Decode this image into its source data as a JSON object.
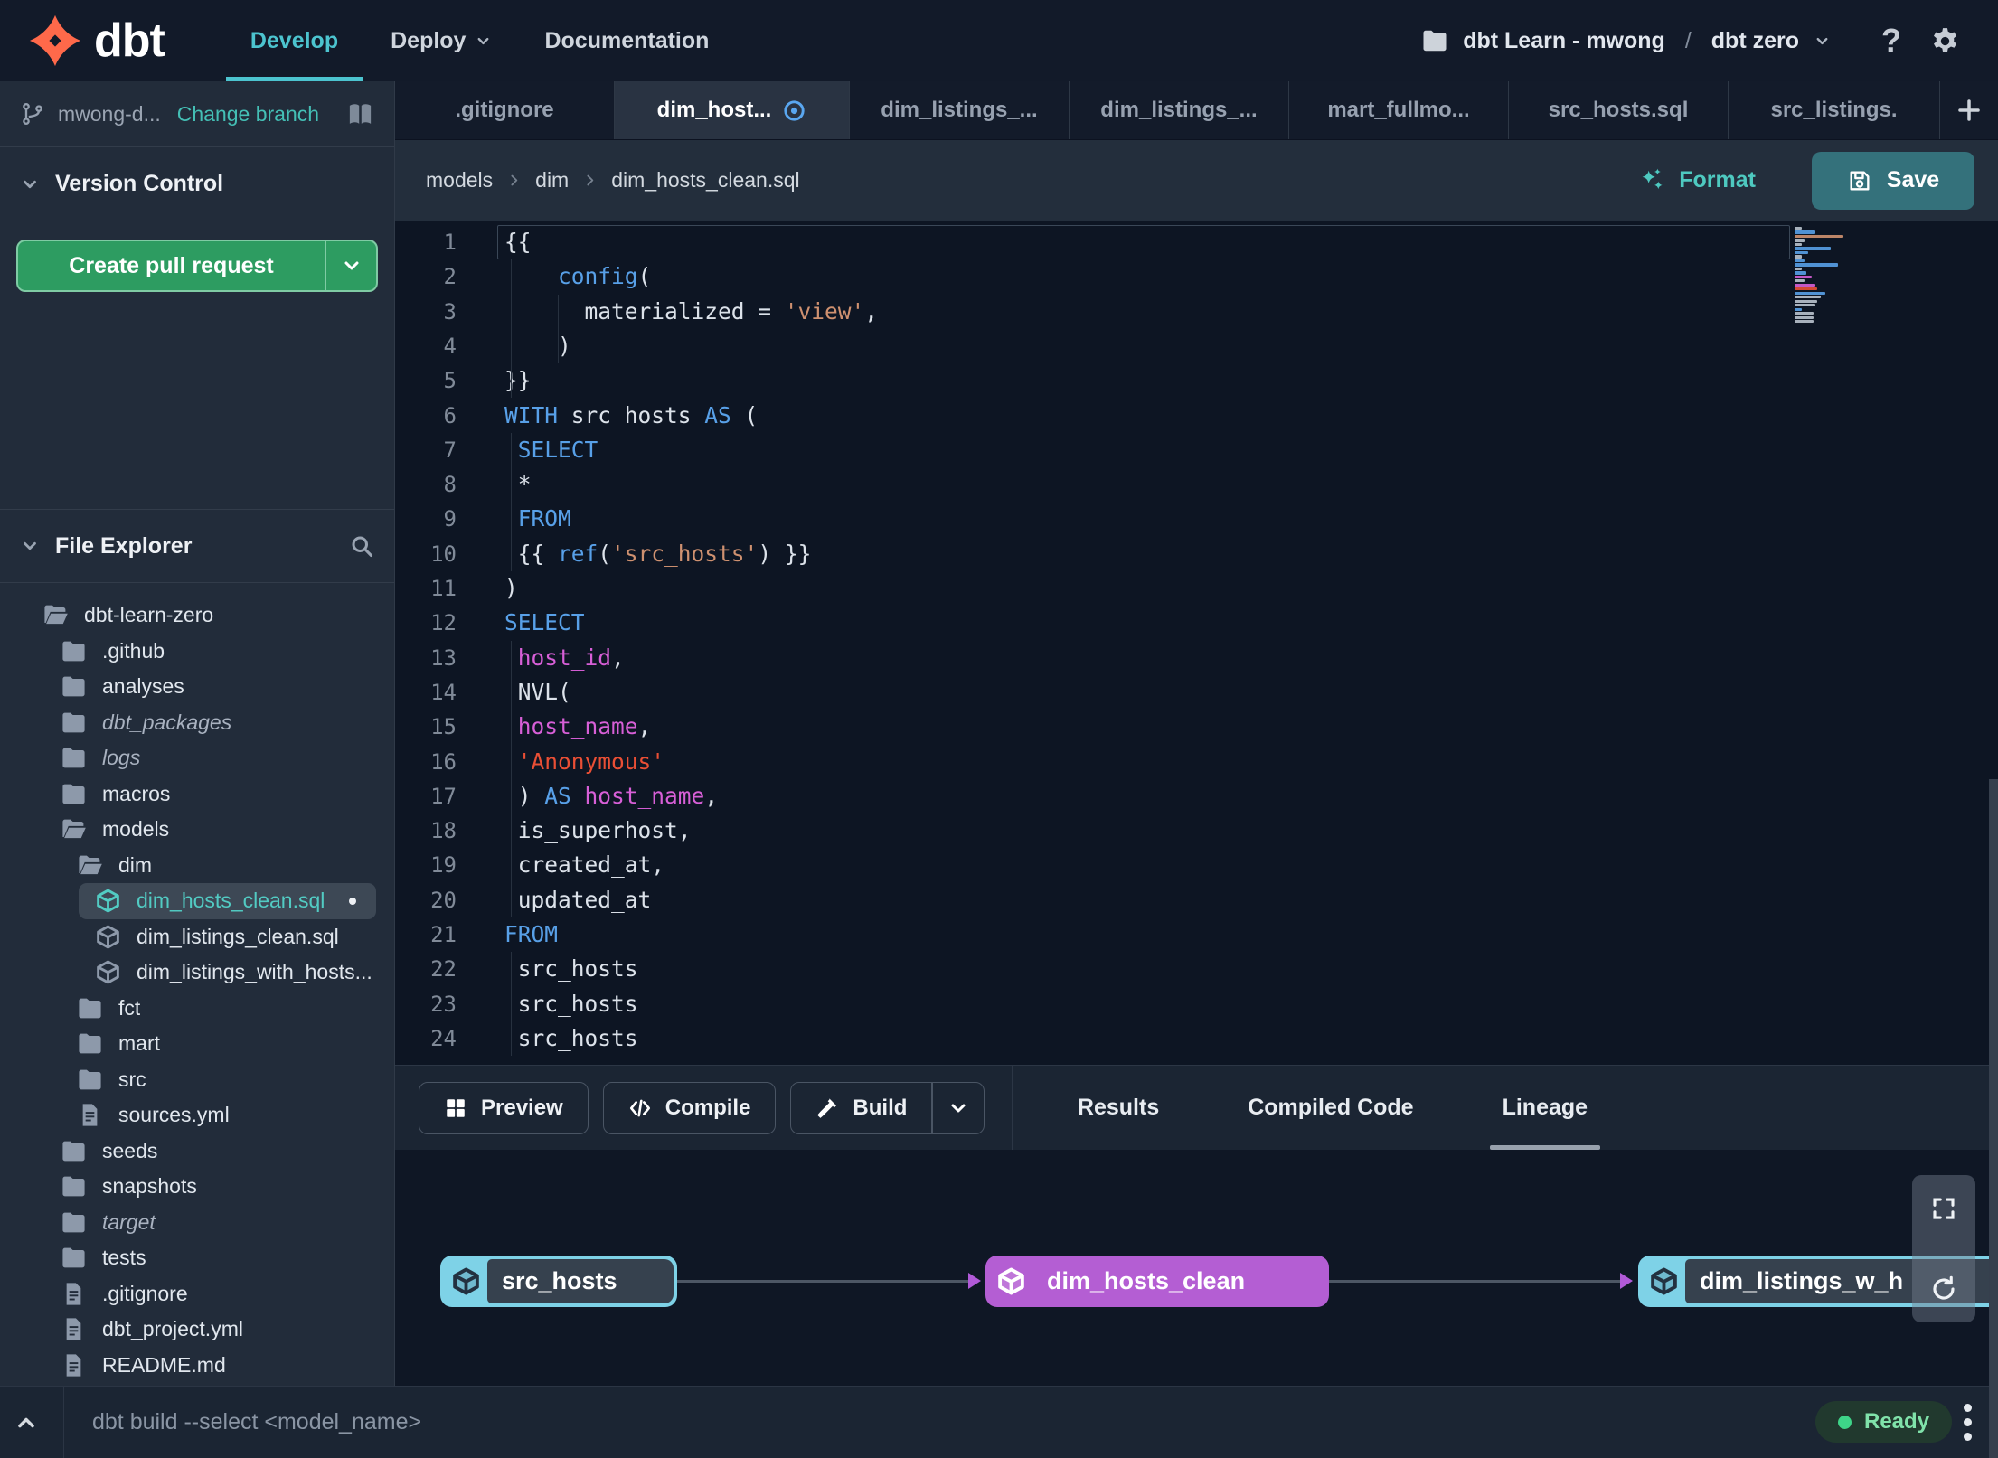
{
  "colors": {
    "accent_teal": "#4cc4cf",
    "link_teal": "#44bfb5",
    "green_button": "#2d9c61",
    "save_button": "#34717b",
    "purple_node": "#b45ed3",
    "cyan_node": "#7ed2e7",
    "ready_green": "#3ed488",
    "tab_icon_blue": "#5aa7f0",
    "code_keyword": "#58a0e8",
    "code_string": "#cf9170",
    "code_red_string": "#ea4f35",
    "code_identifier": "#d75fd7"
  },
  "nav": {
    "brand": "dbt",
    "links": [
      {
        "label": "Develop",
        "active": true
      },
      {
        "label": "Deploy",
        "chevron": true
      },
      {
        "label": "Documentation"
      }
    ],
    "workspace": {
      "icon": "folder",
      "account": "dbt Learn - mwong",
      "separator": "/",
      "project": "dbt zero",
      "chevron_icon": "chevron-down"
    },
    "help_icon": "?",
    "settings_icon": "gear"
  },
  "sidebar": {
    "branch": {
      "icon": "git-branch",
      "name": "mwong-d...",
      "change_branch": "Change branch",
      "book_icon": "book"
    },
    "version_control": {
      "title": "Version Control",
      "chevron_icon": "chevron-down"
    },
    "create_pr": {
      "label": "Create pull request",
      "chevron_icon": "chevron-down"
    },
    "file_explorer": {
      "title": "File Explorer",
      "search_icon": "search",
      "items": [
        {
          "name": "dbt-learn-zero",
          "icon": "folder-open",
          "level": 0
        },
        {
          "name": ".github",
          "icon": "folder",
          "level": 1
        },
        {
          "name": "analyses",
          "icon": "folder",
          "level": 1
        },
        {
          "name": "dbt_packages",
          "icon": "folder",
          "level": 1,
          "italic": true
        },
        {
          "name": "logs",
          "icon": "folder",
          "level": 1,
          "italic": true
        },
        {
          "name": "macros",
          "icon": "folder",
          "level": 1
        },
        {
          "name": "models",
          "icon": "folder-open",
          "level": 1
        },
        {
          "name": "dim",
          "icon": "folder-open",
          "level": 2
        },
        {
          "name": "dim_hosts_clean.sql",
          "icon": "cube",
          "level": 3,
          "selected": true,
          "modified": true
        },
        {
          "name": "dim_listings_clean.sql",
          "icon": "cube",
          "level": 3
        },
        {
          "name": "dim_listings_with_hosts...",
          "icon": "cube",
          "level": 3
        },
        {
          "name": "fct",
          "icon": "folder",
          "level": 2
        },
        {
          "name": "mart",
          "icon": "folder",
          "level": 2
        },
        {
          "name": "src",
          "icon": "folder",
          "level": 2
        },
        {
          "name": "sources.yml",
          "icon": "file",
          "level": 2
        },
        {
          "name": "seeds",
          "icon": "folder",
          "level": 1
        },
        {
          "name": "snapshots",
          "icon": "folder",
          "level": 1
        },
        {
          "name": "target",
          "icon": "folder",
          "level": 1,
          "italic": true
        },
        {
          "name": "tests",
          "icon": "folder",
          "level": 1
        },
        {
          "name": ".gitignore",
          "icon": "file",
          "level": 1
        },
        {
          "name": "dbt_project.yml",
          "icon": "file",
          "level": 1
        },
        {
          "name": "README.md",
          "icon": "file",
          "level": 1
        }
      ]
    }
  },
  "tabs": {
    "items": [
      {
        "label": ".gitignore"
      },
      {
        "label": "dim_host...",
        "active": true,
        "modified": true
      },
      {
        "label": "dim_listings_..."
      },
      {
        "label": "dim_listings_..."
      },
      {
        "label": "mart_fullmo..."
      },
      {
        "label": "src_hosts.sql"
      },
      {
        "label": "src_listings."
      }
    ],
    "add_icon": "plus"
  },
  "breadcrumb": [
    "models",
    "dim",
    "dim_hosts_clean.sql"
  ],
  "file_actions": {
    "format": "Format",
    "save": "Save"
  },
  "editor": {
    "lines": [
      {
        "n": "1",
        "current": true,
        "tokens": [
          [
            "{{",
            "pl"
          ]
        ]
      },
      {
        "n": "2",
        "tokens": [
          [
            "    ",
            "pl"
          ],
          [
            "config",
            "kw"
          ],
          [
            "(",
            "pl"
          ]
        ]
      },
      {
        "n": "3",
        "tokens": [
          [
            "      materialized = ",
            "pl"
          ],
          [
            "'view'",
            "str"
          ],
          [
            ",",
            "pl"
          ]
        ]
      },
      {
        "n": "4",
        "tokens": [
          [
            "    )",
            "pl"
          ]
        ]
      },
      {
        "n": "5",
        "tokens": [
          [
            "}}",
            "pl"
          ]
        ]
      },
      {
        "n": "6",
        "tokens": [
          [
            "WITH",
            "kw"
          ],
          [
            " src_hosts ",
            "pl"
          ],
          [
            "AS",
            "kw"
          ],
          [
            " (",
            "pl"
          ]
        ]
      },
      {
        "n": "7",
        "tokens": [
          [
            " ",
            "pl"
          ],
          [
            "SELECT",
            "kw"
          ]
        ]
      },
      {
        "n": "8",
        "tokens": [
          [
            " *",
            "pl"
          ]
        ]
      },
      {
        "n": "9",
        "tokens": [
          [
            " ",
            "pl"
          ],
          [
            "FROM",
            "kw"
          ]
        ]
      },
      {
        "n": "10",
        "tokens": [
          [
            " {{ ",
            "pl"
          ],
          [
            "ref",
            "kw"
          ],
          [
            "(",
            "pl"
          ],
          [
            "'src_hosts'",
            "str"
          ],
          [
            ") }}",
            "pl"
          ]
        ]
      },
      {
        "n": "11",
        "tokens": [
          [
            ")",
            "pl"
          ]
        ]
      },
      {
        "n": "12",
        "tokens": [
          [
            "SELECT",
            "kw"
          ]
        ]
      },
      {
        "n": "13",
        "tokens": [
          [
            " ",
            "pl"
          ],
          [
            "host_id",
            "id"
          ],
          [
            ",",
            "pl"
          ]
        ]
      },
      {
        "n": "14",
        "tokens": [
          [
            " NVL(",
            "pl"
          ]
        ]
      },
      {
        "n": "15",
        "tokens": [
          [
            " ",
            "pl"
          ],
          [
            "host_name",
            "id"
          ],
          [
            ",",
            "pl"
          ]
        ]
      },
      {
        "n": "16",
        "tokens": [
          [
            " ",
            "pl"
          ],
          [
            "'Anonymous'",
            "red"
          ]
        ]
      },
      {
        "n": "17",
        "tokens": [
          [
            " ) ",
            "pl"
          ],
          [
            "AS",
            "kw"
          ],
          [
            " ",
            "pl"
          ],
          [
            "host_name",
            "id"
          ],
          [
            ",",
            "pl"
          ]
        ]
      },
      {
        "n": "18",
        "tokens": [
          [
            " is_superhost,",
            "pl"
          ]
        ]
      },
      {
        "n": "19",
        "tokens": [
          [
            " created_at,",
            "pl"
          ]
        ]
      },
      {
        "n": "20",
        "tokens": [
          [
            " updated_at",
            "pl"
          ]
        ]
      },
      {
        "n": "21",
        "tokens": [
          [
            "FROM",
            "kw"
          ]
        ]
      },
      {
        "n": "22",
        "tokens": [
          [
            " src_hosts",
            "pl"
          ]
        ]
      },
      {
        "n": "23",
        "tokens": [
          [
            " src_hosts",
            "pl"
          ]
        ]
      },
      {
        "n": "24",
        "tokens": [
          [
            " src_hosts",
            "pl"
          ]
        ]
      }
    ]
  },
  "bottom_panel": {
    "buttons": [
      {
        "label": "Preview",
        "icon": "grid"
      },
      {
        "label": "Compile",
        "icon": "code"
      },
      {
        "label": "Build",
        "icon": "hammer",
        "split": true
      }
    ],
    "tabs": [
      {
        "label": "Results"
      },
      {
        "label": "Compiled Code"
      },
      {
        "label": "Lineage",
        "active": true
      }
    ]
  },
  "lineage": {
    "nodes": [
      {
        "label": "src_hosts",
        "type": "source"
      },
      {
        "label": "dim_hosts_clean",
        "type": "model"
      },
      {
        "label": "dim_listings_w_h",
        "type": "source"
      }
    ],
    "controls": [
      "fullscreen",
      "refresh"
    ]
  },
  "status_bar": {
    "command": "dbt build --select <model_name>",
    "status": "Ready"
  }
}
